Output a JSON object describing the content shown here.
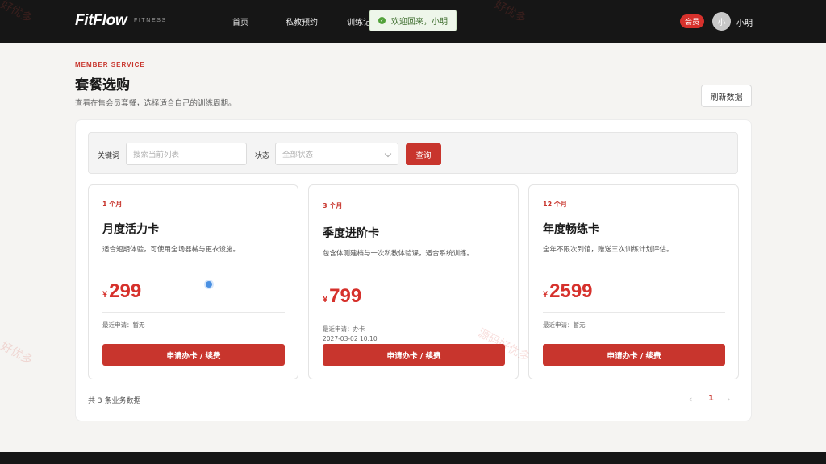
{
  "header": {
    "logo": "FitFlow",
    "logo_sub": "FITNESS",
    "nav": [
      "首页",
      "私教预约",
      "训练记"
    ],
    "toast": "欢迎回来，小明",
    "member_badge": "会员",
    "avatar_text": "小",
    "username": "小明"
  },
  "page": {
    "kicker": "MEMBER SERVICE",
    "title": "套餐选购",
    "description": "查看在售会员套餐，选择适合自己的训练周期。",
    "refresh_label": "刷新数据"
  },
  "filter": {
    "keyword_label": "关键词",
    "keyword_placeholder": "搜索当前列表",
    "status_label": "状态",
    "status_value": "全部状态",
    "query_label": "查询"
  },
  "cards": [
    {
      "period": "1 个月",
      "name": "月度活力卡",
      "desc": "适合短期体验，可使用全场器械与更衣设施。",
      "currency": "¥",
      "price": "299",
      "meta_label": "最近申请：暂无",
      "meta_time": "",
      "button": "申请办卡 / 续费"
    },
    {
      "period": "3 个月",
      "name": "季度进阶卡",
      "desc": "包含体测建档与一次私教体验课，适合系统训练。",
      "currency": "¥",
      "price": "799",
      "meta_label": "最近申请：办卡",
      "meta_time": "2027-03-02 10:10",
      "button": "申请办卡 / 续费"
    },
    {
      "period": "12 个月",
      "name": "年度畅练卡",
      "desc": "全年不限次到馆，赠送三次训练计划评估。",
      "currency": "¥",
      "price": "2599",
      "meta_label": "最近申请：暂无",
      "meta_time": "",
      "button": "申请办卡 / 续费"
    }
  ],
  "pagination": {
    "total": "共 3 条业务数据",
    "prev": "‹",
    "current": "1",
    "next": "›"
  },
  "watermark": [
    "源码好优多",
    "好优多"
  ],
  "colors": {
    "accent": "#c8352d",
    "topbar": "#161616",
    "toast_bg": "#eef6ea"
  }
}
